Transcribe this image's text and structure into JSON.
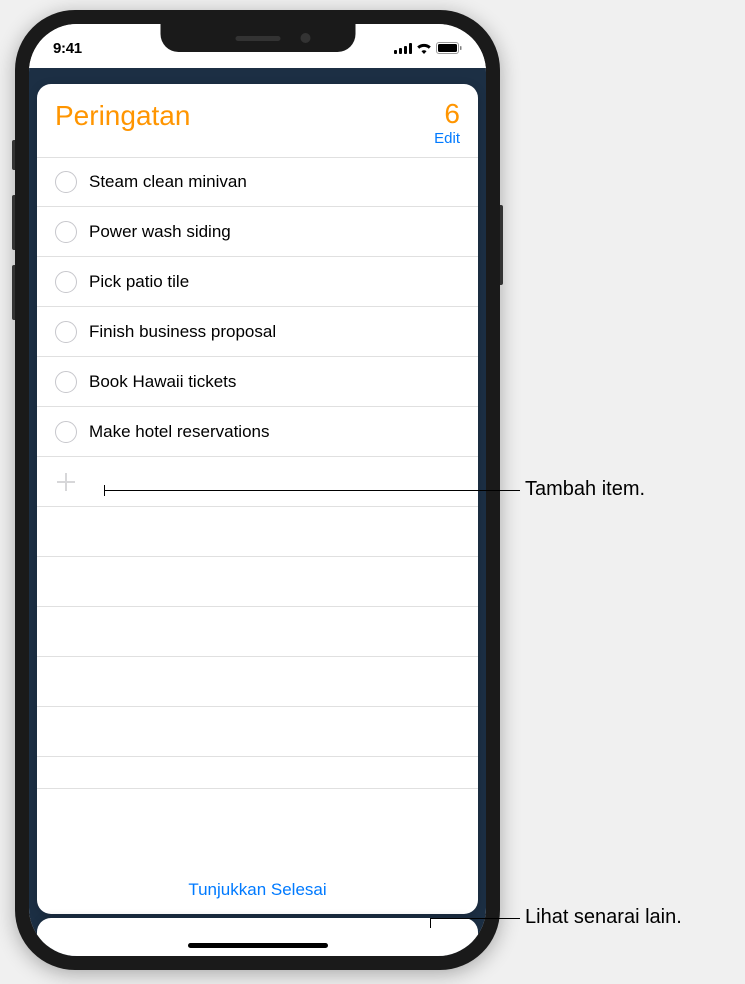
{
  "status": {
    "time": "9:41"
  },
  "header": {
    "title": "Peringatan",
    "count": "6",
    "edit": "Edit"
  },
  "reminders": [
    "Steam clean minivan",
    "Power wash siding",
    "Pick patio tile",
    "Finish business proposal",
    "Book Hawaii tickets",
    "Make hotel reservations"
  ],
  "footer": {
    "show_completed": "Tunjukkan Selesai"
  },
  "callouts": {
    "add_item": "Tambah item.",
    "view_lists": "Lihat senarai lain."
  }
}
